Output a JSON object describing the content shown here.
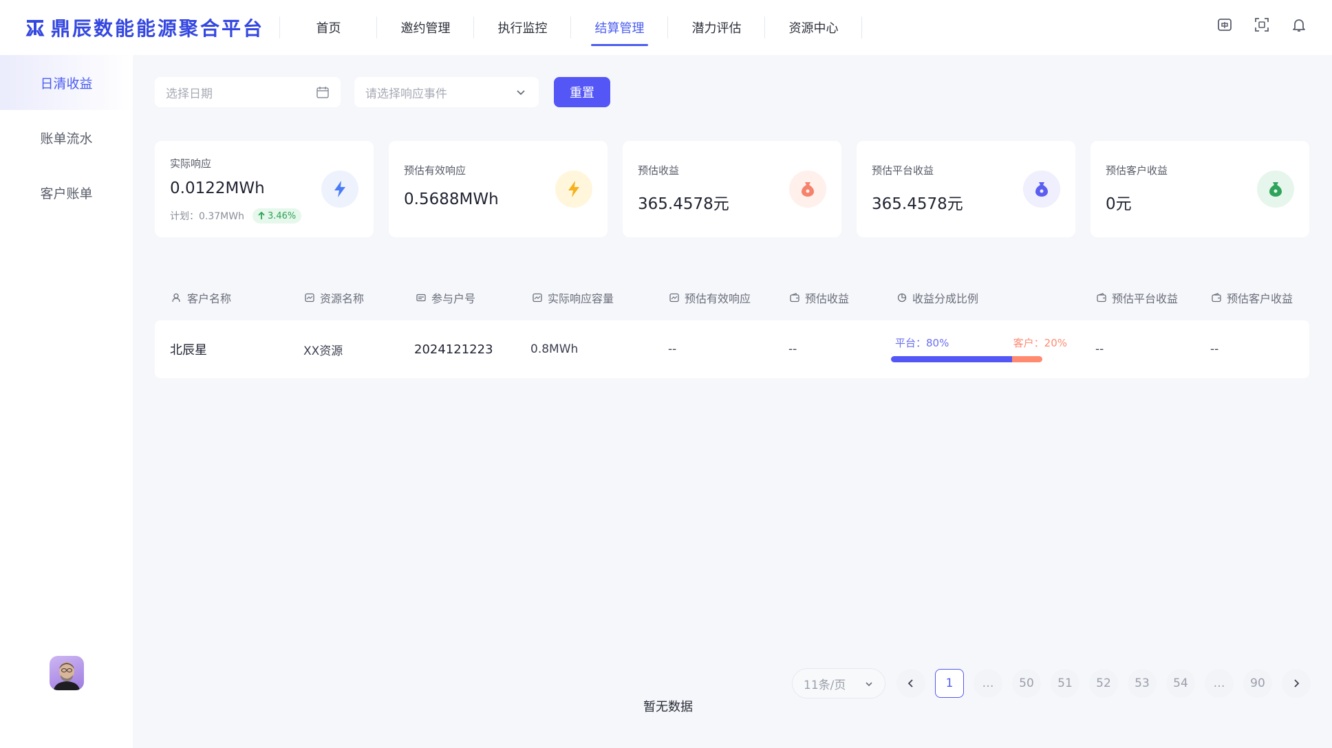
{
  "brand": {
    "name": "鼎辰数能能源聚合平台"
  },
  "nav": {
    "items": [
      {
        "label": "首页"
      },
      {
        "label": "邀约管理"
      },
      {
        "label": "执行监控"
      },
      {
        "label": "结算管理"
      },
      {
        "label": "潜力评估"
      },
      {
        "label": "资源中心"
      }
    ],
    "active_index": 3
  },
  "header_icons": [
    "language-switch-icon",
    "fullscreen-icon",
    "bell-icon"
  ],
  "sidebar": {
    "items": [
      {
        "label": "日清收益"
      },
      {
        "label": "账单流水"
      },
      {
        "label": "客户账单"
      }
    ],
    "active_index": 0
  },
  "filters": {
    "date_placeholder": "选择日期",
    "event_placeholder": "请选择响应事件",
    "reset_label": "重置"
  },
  "stats": [
    {
      "label": "实际响应",
      "value": "0.0122MWh",
      "sub_label": "计划：0.37MWh",
      "trend": "3.46%",
      "icon": "lightning-icon",
      "icon_color": "#4a7cf5",
      "icon_bg": "#eef2fd"
    },
    {
      "label": "预估有效响应",
      "value": "0.5688MWh",
      "icon": "lightning-icon",
      "icon_color": "#f5b21e",
      "icon_bg": "#fff6dc"
    },
    {
      "label": "预估收益",
      "value": "365.4578元",
      "icon": "money-bag-icon",
      "icon_color": "#f5826a",
      "icon_bg": "#fff0ec"
    },
    {
      "label": "预估平台收益",
      "value": "365.4578元",
      "icon": "money-bag-icon",
      "icon_color": "#5b5ef0",
      "icon_bg": "#efeffd"
    },
    {
      "label": "预估客户收益",
      "value": "0元",
      "icon": "money-bag-icon",
      "icon_color": "#2fa35a",
      "icon_bg": "#e7f6ec"
    }
  ],
  "table": {
    "columns": [
      {
        "label": "客户名称",
        "icon": "user-icon"
      },
      {
        "label": "资源名称",
        "icon": "chart-box-icon"
      },
      {
        "label": "参与户号",
        "icon": "card-icon"
      },
      {
        "label": "实际响应容量",
        "icon": "chart-box-icon"
      },
      {
        "label": "预估有效响应",
        "icon": "chart-box-icon"
      },
      {
        "label": "预估收益",
        "icon": "wallet-icon"
      },
      {
        "label": "收益分成比例",
        "icon": "pie-icon"
      },
      {
        "label": "预估平台收益",
        "icon": "wallet-icon"
      },
      {
        "label": "预估客户收益",
        "icon": "wallet-icon"
      }
    ],
    "rows": [
      {
        "customer": "北辰星",
        "resource": "XX资源",
        "account": "2024121223",
        "actual_capacity": "0.8MWh",
        "effective_response": "--",
        "revenue": "--",
        "ratio": {
          "platform_label": "平台：80%",
          "customer_label": "客户：20%",
          "platform_fraction": 0.8,
          "customer_fraction": 0.2
        },
        "platform_revenue": "--",
        "customer_revenue": "--"
      }
    ]
  },
  "empty_text": "暂无数据",
  "pagination": {
    "page_size_label": "11条/页",
    "pages": [
      "1",
      "…",
      "50",
      "51",
      "52",
      "53",
      "54",
      "…",
      "90"
    ],
    "current": "1"
  },
  "colors": {
    "accent": "#5457f5",
    "customer_share": "#ff8a70"
  }
}
